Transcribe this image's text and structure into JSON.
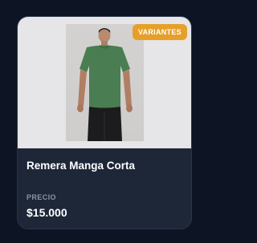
{
  "product": {
    "badge": "VARIANTES",
    "name": "Remera Manga Corta",
    "price_label": "PRECIO",
    "price": "$15.000",
    "image_icon": "product-photo-tshirt-model"
  },
  "colors": {
    "background": "#0d1424",
    "card": "#1d2738",
    "badge": "#e6a02a",
    "shirt": "#4a7d52"
  }
}
